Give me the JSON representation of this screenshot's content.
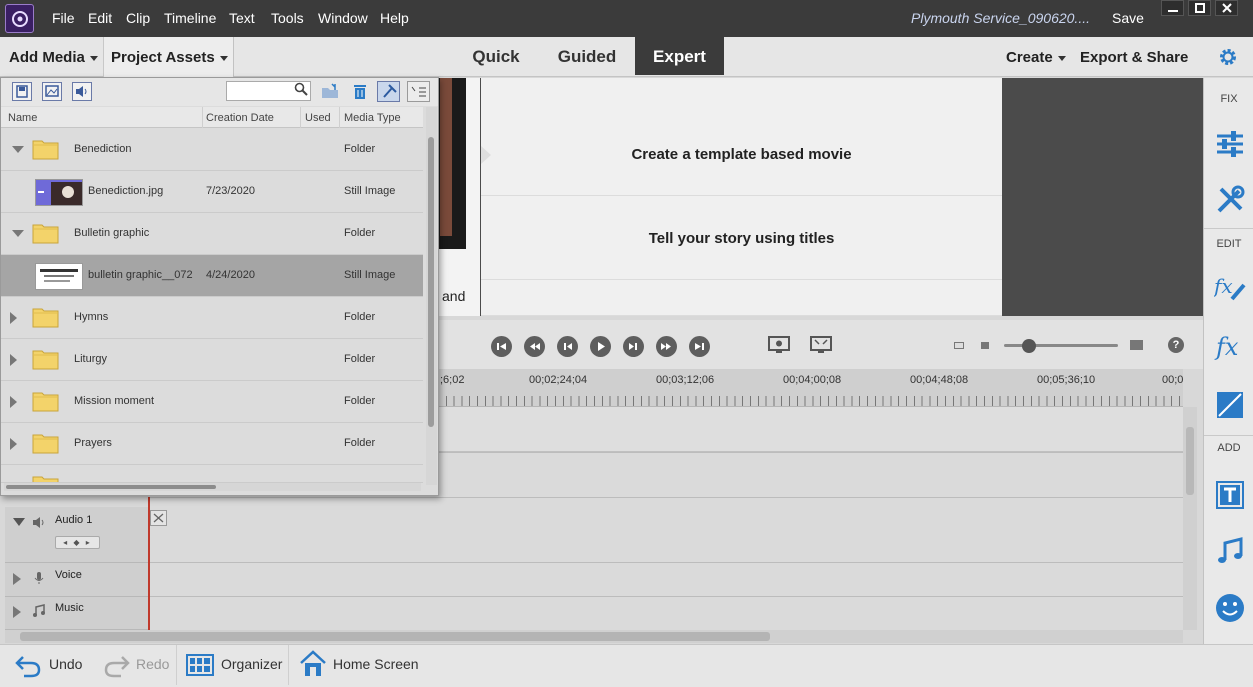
{
  "menubar": {
    "items": [
      "File",
      "Edit",
      "Clip",
      "Timeline",
      "Text",
      "Tools",
      "Window",
      "Help"
    ],
    "doc_title": "Plymouth Service_090620....",
    "save_label": "Save"
  },
  "modebar": {
    "add_media": "Add Media",
    "project_assets": "Project Assets",
    "tabs": [
      {
        "label": "Quick",
        "active": false
      },
      {
        "label": "Guided",
        "active": false
      },
      {
        "label": "Expert",
        "active": true
      }
    ],
    "create": "Create",
    "export_share": "Export & Share"
  },
  "right_panel": {
    "fix_label": "FIX",
    "edit_label": "EDIT",
    "add_label": "ADD"
  },
  "preview": {
    "partial_text": "and",
    "template_rows": [
      "Create a template based movie",
      "Tell your story using titles"
    ]
  },
  "timeline": {
    "timecodes": [
      ";6;02",
      "00;02;24;04",
      "00;03;12;06",
      "00;04;00;08",
      "00;04;48;08",
      "00;05;36;10",
      "00;0"
    ],
    "tracks": [
      {
        "label": "Audio 1",
        "audio_ctrl": "◂ ◆ ▸"
      },
      {
        "label": "Voice"
      },
      {
        "label": "Music"
      }
    ]
  },
  "assets": {
    "search_value": "",
    "columns": [
      "Name",
      "Creation Date",
      "Used",
      "Media Type"
    ],
    "rows": [
      {
        "name": "Benediction",
        "date": "",
        "type": "Folder",
        "kind": "folder",
        "expanded": true,
        "selected": false
      },
      {
        "name": "Benediction.jpg",
        "date": "7/23/2020",
        "type": "Still Image",
        "kind": "image",
        "selected": false
      },
      {
        "name": "Bulletin graphic",
        "date": "",
        "type": "Folder",
        "kind": "folder",
        "expanded": true,
        "selected": false
      },
      {
        "name": "bulletin graphic__072",
        "date": "4/24/2020",
        "type": "Still Image",
        "kind": "image2",
        "selected": true
      },
      {
        "name": "Hymns",
        "date": "",
        "type": "Folder",
        "kind": "folder",
        "expanded": false,
        "selected": false
      },
      {
        "name": "Liturgy",
        "date": "",
        "type": "Folder",
        "kind": "folder",
        "expanded": false,
        "selected": false
      },
      {
        "name": "Mission moment",
        "date": "",
        "type": "Folder",
        "kind": "folder",
        "expanded": false,
        "selected": false
      },
      {
        "name": "Prayers",
        "date": "",
        "type": "Folder",
        "kind": "folder",
        "expanded": false,
        "selected": false
      }
    ]
  },
  "bottombar": {
    "undo": "Undo",
    "redo": "Redo",
    "organizer": "Organizer",
    "home_screen": "Home Screen"
  },
  "colors": {
    "accent_blue": "#2b7bc6",
    "dark_chrome": "#3b3b3b",
    "playhead": "#c0392b"
  }
}
